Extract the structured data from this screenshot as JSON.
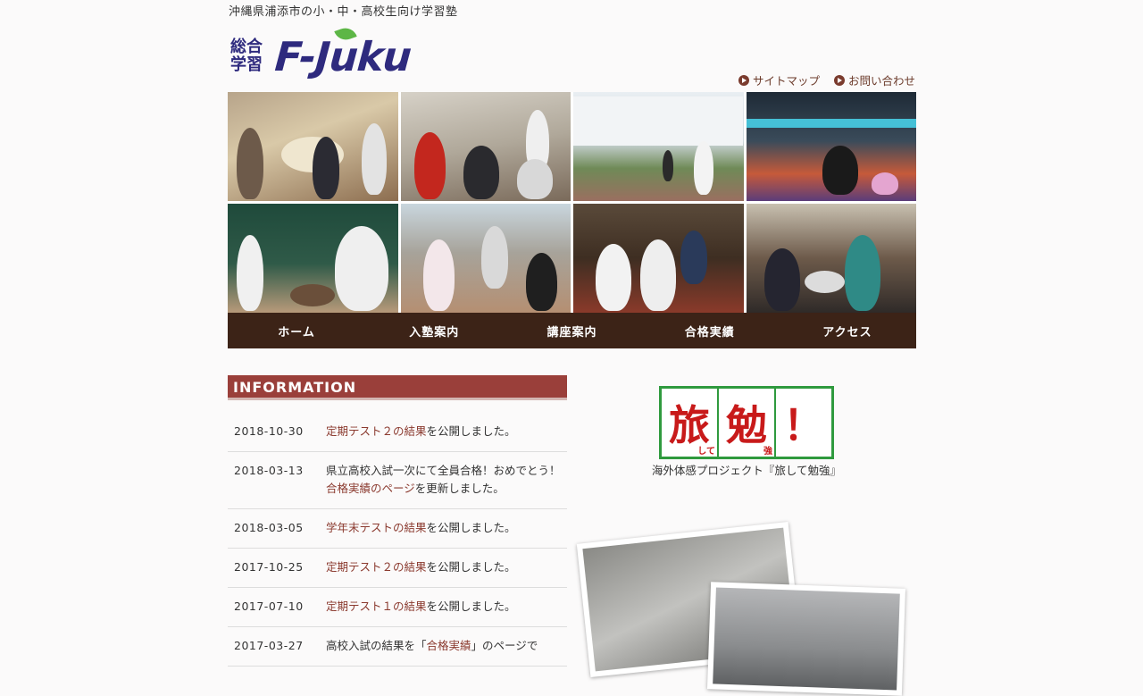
{
  "header": {
    "tagline": "沖縄県浦添市の小・中・高校生向け学習塾",
    "logo_kanji": "総合学習",
    "logo_brand": "F-Juku"
  },
  "top_links": [
    {
      "label": "サイトマップ"
    },
    {
      "label": "お問い合わせ"
    }
  ],
  "nav": [
    {
      "label": "ホーム"
    },
    {
      "label": "入塾案内"
    },
    {
      "label": "講座案内"
    },
    {
      "label": "合格実績"
    },
    {
      "label": "アクセス"
    }
  ],
  "information": {
    "title": "INFORMATION",
    "items": [
      {
        "date": "2018-10-30",
        "link": "定期テスト２の結果",
        "rest": "を公開しました。",
        "pre": ""
      },
      {
        "date": "2018-03-13",
        "pre": "県立高校入試一次にて全員合格！おめでとう！",
        "link": "合格実績のページ",
        "rest": "を更新しました。"
      },
      {
        "date": "2018-03-05",
        "pre": "",
        "link": "学年末テストの結果",
        "rest": "を公開しました。"
      },
      {
        "date": "2017-10-25",
        "pre": "",
        "link": "定期テスト２の結果",
        "rest": "を公開しました。"
      },
      {
        "date": "2017-07-10",
        "pre": "",
        "link": "定期テスト１の結果",
        "rest": "を公開しました。"
      },
      {
        "date": "2017-03-27",
        "pre": "高校入試の結果を「",
        "link": "合格実績",
        "rest": "」のページで"
      }
    ]
  },
  "banner": {
    "chars": [
      "旅",
      "勉",
      "！"
    ],
    "small": [
      "して",
      "強"
    ],
    "caption": "海外体感プロジェクト『旅して勉強』"
  },
  "colors": {
    "nav_bg": "#3c2317",
    "info_header": "#9a3f3a",
    "link": "#8b3a2f",
    "brand": "#2e2a7e",
    "banner_red": "#c81a1a",
    "banner_green": "#2f9a3e"
  }
}
